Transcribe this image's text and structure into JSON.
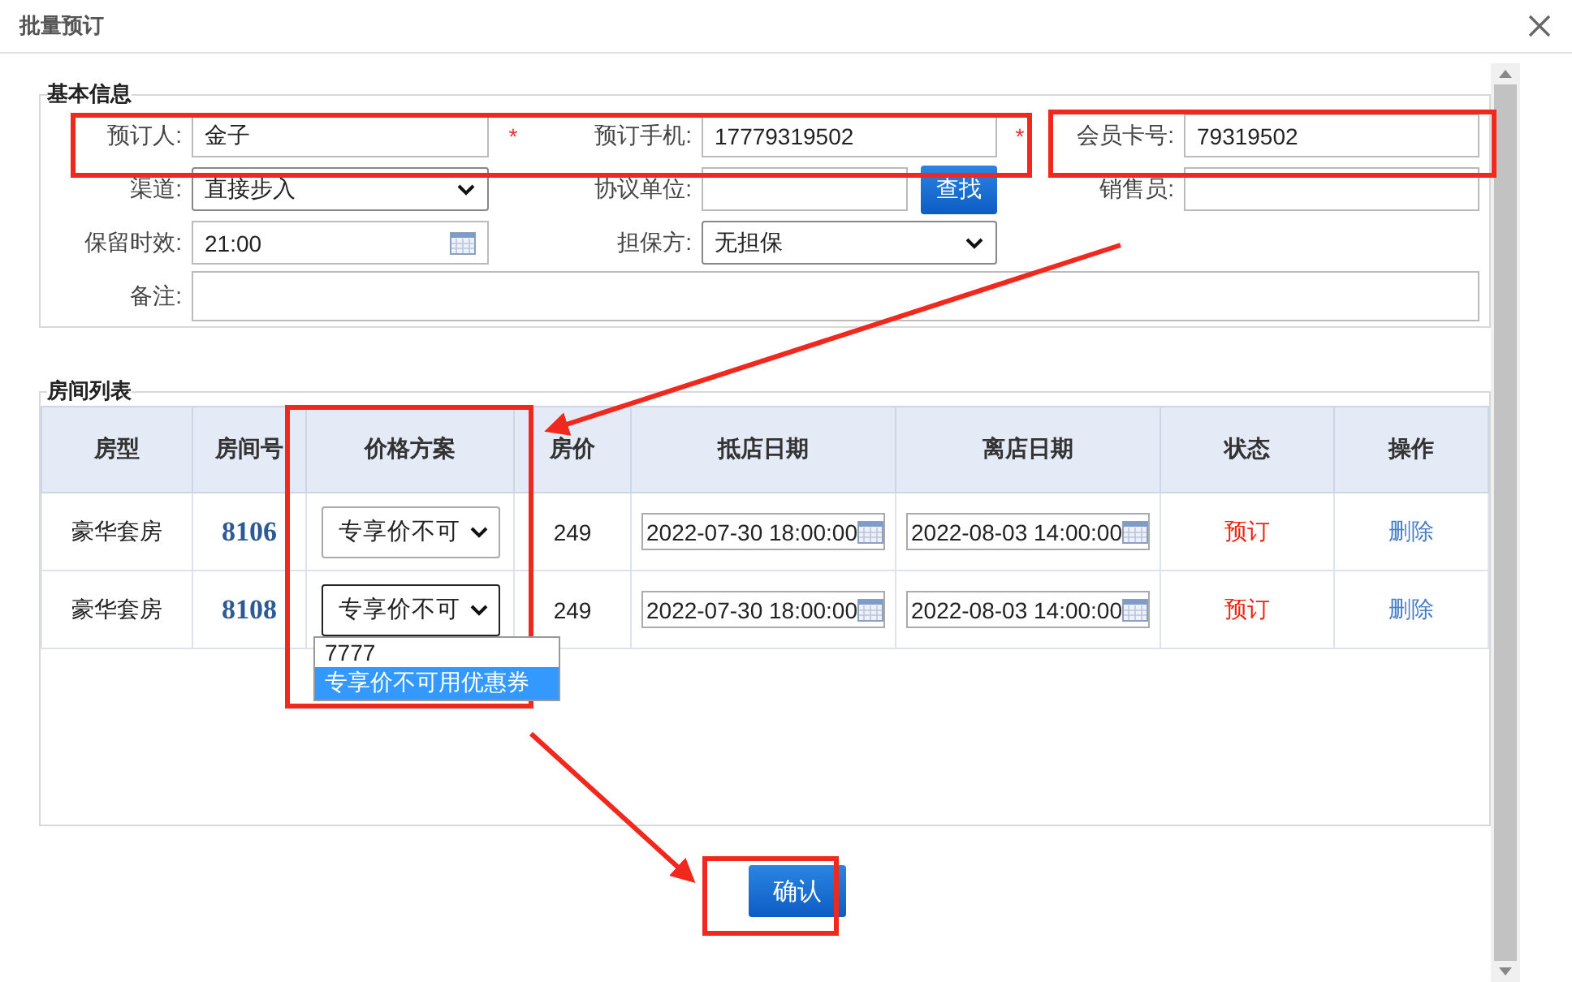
{
  "window": {
    "title": "批量预订"
  },
  "basic_info": {
    "legend": "基本信息",
    "fields": [
      {
        "label": "预订人:",
        "kind": "text",
        "value": "金子",
        "required": true,
        "required_mark": "*"
      },
      {
        "label": "预订手机:",
        "kind": "text",
        "value": "17779319502",
        "required": true,
        "required_mark": "*"
      },
      {
        "label": "会员卡号:",
        "kind": "text",
        "value": "79319502",
        "required": false
      },
      {
        "label": "渠道:",
        "kind": "select",
        "value": "直接步入",
        "required": false
      },
      {
        "label": "协议单位:",
        "kind": "lookup",
        "button": "查找",
        "required": false
      },
      {
        "label": "销售员:",
        "kind": "text",
        "required": false
      },
      {
        "label": "保留时效:",
        "kind": "date",
        "value": "21:00",
        "required": false
      },
      {
        "label": "担保方:",
        "kind": "select",
        "value": "无担保",
        "required": false
      },
      {
        "label": "备注:",
        "kind": "wide",
        "required": false
      }
    ]
  },
  "room_list": {
    "legend": "房间列表",
    "columns": [
      "房型",
      "房间号",
      "价格方案",
      "房价",
      "抵店日期",
      "离店日期",
      "状态",
      "操作"
    ],
    "rows": [
      {
        "type": "豪华套房",
        "number": "8106",
        "plan": "专享价不可",
        "plan_open": false,
        "price": "249",
        "arrival": "2022-07-30 18:00:00",
        "departure": "2022-08-03 14:00:00",
        "status": "预订",
        "action": "删除"
      },
      {
        "type": "豪华套房",
        "number": "8108",
        "plan": "专享价不可",
        "plan_open": true,
        "plan_options": [
          {
            "label": "7777",
            "selected": false
          },
          {
            "label": "专享价不可用优惠券",
            "selected": true
          }
        ],
        "price": "249",
        "arrival": "2022-07-30 18:00:00",
        "departure": "2022-08-03 14:00:00",
        "status": "预订",
        "action": "删除"
      }
    ]
  },
  "confirm_button": "确认"
}
